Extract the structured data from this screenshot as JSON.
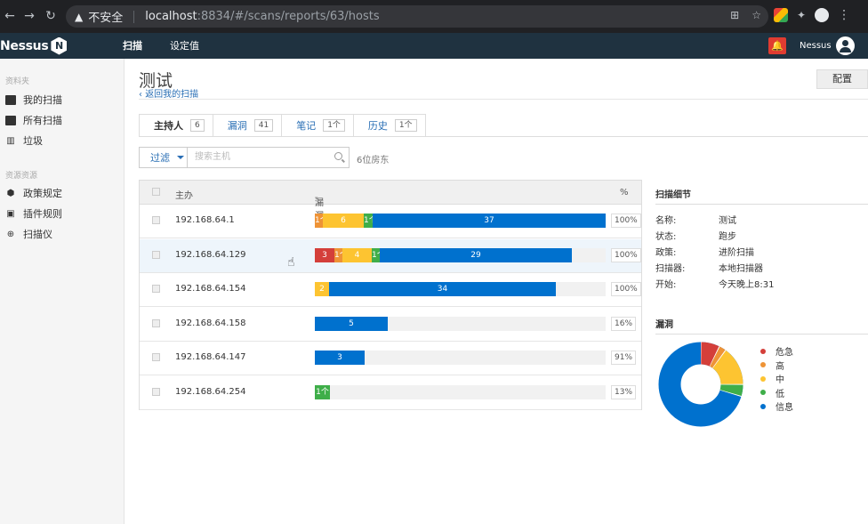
{
  "browser": {
    "insecure_label": "不安全",
    "url_host": "localhost",
    "url_path": ":8834/#/scans/reports/63/hosts"
  },
  "nav": {
    "logo": "Nessus",
    "logo_mark": "N",
    "tab_scans": "扫描",
    "tab_settings": "设定值",
    "user": "Nessus"
  },
  "sidebar": {
    "section_folders": "资料夹",
    "my_scans": "我的扫描",
    "all_scans": "所有扫描",
    "trash": "垃圾",
    "section_resources": "资源资源",
    "policies": "政策规定",
    "plugin_rules": "插件规则",
    "scanners": "扫描仪"
  },
  "page": {
    "title": "测试",
    "back": "返回我的扫描",
    "config": "配置"
  },
  "tabs": [
    {
      "label": "主持人",
      "count": "6"
    },
    {
      "label": "漏洞",
      "count": "41"
    },
    {
      "label": "笔记",
      "count": "1个"
    },
    {
      "label": "历史",
      "count": "1个"
    }
  ],
  "filter": {
    "label": "过滤",
    "search_placeholder": "搜索主机",
    "host_count": "6位房东"
  },
  "table": {
    "col_host": "主办",
    "col_vulns": "漏洞",
    "col_pct": "%",
    "rows": [
      {
        "ip": "192.168.64.1",
        "pct": "100%",
        "segs": [
          [
            "1个",
            "#ee9336"
          ],
          [
            "6",
            "#fdc431"
          ],
          [
            "1个",
            "#3fae49"
          ],
          [
            "37",
            "#0071ce"
          ]
        ]
      },
      {
        "ip": "192.168.64.129",
        "pct": "100%",
        "segs": [
          [
            "3",
            "#d43f3a"
          ],
          [
            "1个",
            "#ee9336"
          ],
          [
            "4",
            "#fdc431"
          ],
          [
            "1个",
            "#3fae49"
          ],
          [
            "29",
            "#0071ce"
          ]
        ]
      },
      {
        "ip": "192.168.64.154",
        "pct": "100%",
        "segs": [
          [
            "2",
            "#fdc431"
          ],
          [
            "34",
            "#0071ce"
          ]
        ]
      },
      {
        "ip": "192.168.64.158",
        "pct": "16%",
        "segs": [
          [
            "5",
            "#0071ce"
          ]
        ]
      },
      {
        "ip": "192.168.64.147",
        "pct": "91%",
        "segs": [
          [
            "3",
            "#0071ce"
          ]
        ]
      },
      {
        "ip": "192.168.64.254",
        "pct": "13%",
        "segs": [
          [
            "1个",
            "#3fae49"
          ]
        ]
      }
    ]
  },
  "scan_details": {
    "title": "扫描细节",
    "name_k": "名称:",
    "name_v": "测试",
    "status_k": "状态:",
    "status_v": "跑步",
    "policy_k": "政策:",
    "policy_v": "进阶扫描",
    "scanner_k": "扫描器:",
    "scanner_v": "本地扫描器",
    "start_k": "开始:",
    "start_v": "今天晚上8:31"
  },
  "vulns_panel": {
    "title": "漏洞",
    "legend": [
      {
        "label": "危急",
        "color": "#d43f3a"
      },
      {
        "label": "高",
        "color": "#ee9336"
      },
      {
        "label": "中",
        "color": "#fdc431"
      },
      {
        "label": "低",
        "color": "#3fae49"
      },
      {
        "label": "信息",
        "color": "#0071ce"
      }
    ]
  }
}
